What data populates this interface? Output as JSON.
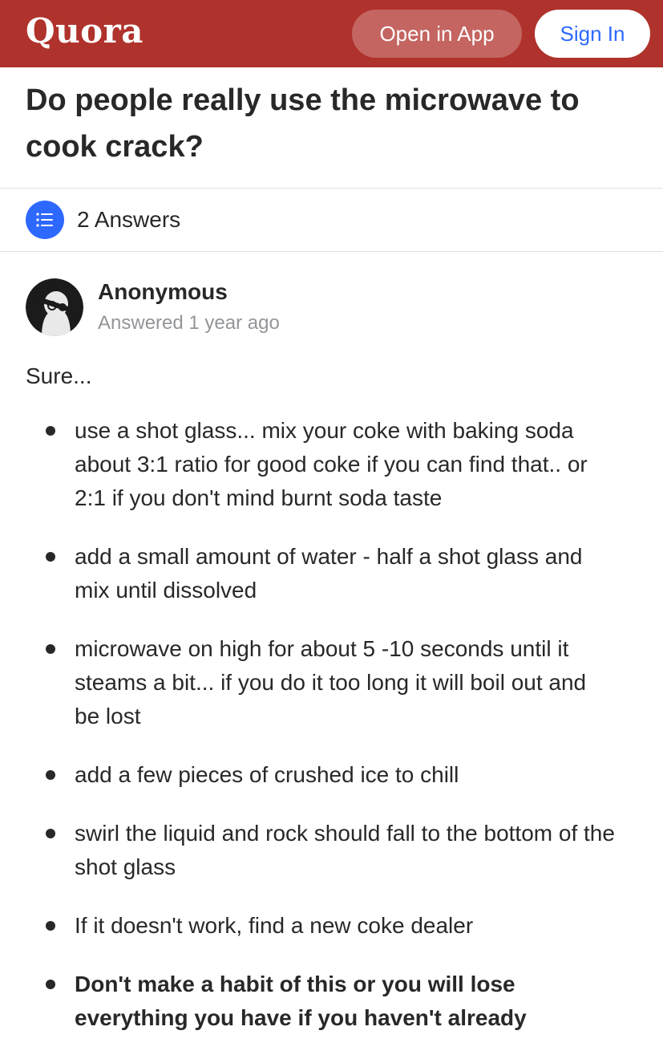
{
  "header": {
    "logo": "Quora",
    "open_in_app_label": "Open in App",
    "sign_in_label": "Sign In",
    "brand_color": "#b0322c",
    "accent_color": "#2e69ff"
  },
  "question": {
    "title": "Do people really use the microwave to cook crack?"
  },
  "answers_bar": {
    "icon": "list-icon",
    "count_label": "2 Answers"
  },
  "answer": {
    "author_name": "Anonymous",
    "answered_time": "Answered 1 year ago",
    "intro": "Sure...",
    "points": [
      "use a shot glass... mix your coke with baking soda about 3:1 ratio for good coke if you can find that.. or 2:1 if you don't mind burnt soda taste",
      "add a small amount of water - half a shot glass and mix until dissolved",
      "microwave on high for about 5 -10 seconds until it steams a bit... if you do it too long it will boil out and be lost",
      "add a few pieces of crushed ice to chill",
      "swirl the liquid and rock should fall to the bottom of the shot glass",
      "If it doesn't work, find a new coke dealer",
      "Don't make a habit of this or you will lose everything you have if you haven't already"
    ]
  }
}
